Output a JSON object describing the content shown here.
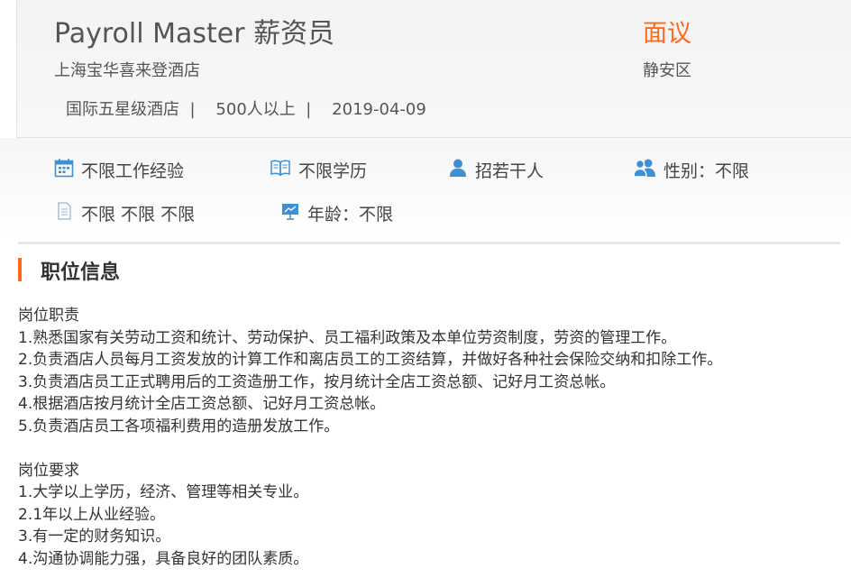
{
  "job": {
    "title": "Payroll Master 薪资员",
    "salary": "面议",
    "company": "上海宝华喜来登酒店",
    "district": "静安区",
    "meta": [
      "国际五星级酒店",
      "500人以上",
      "2019-04-09"
    ],
    "meta_separator": "|"
  },
  "requirements": {
    "experience": "不限工作经验",
    "education": "不限学历",
    "headcount": "招若干人",
    "gender": "性别：不限",
    "other": "不限 不限 不限",
    "age": "年龄：不限"
  },
  "section": {
    "title": "职位信息"
  },
  "description": {
    "duties_heading": "岗位职责",
    "duties": [
      "1.熟悉国家有关劳动工资和统计、劳动保护、员工福利政策及本单位劳资制度，劳资的管理工作。",
      "2.负责酒店人员每月工资发放的计算工作和离店员工的工资结算，并做好各种社会保险交纳和扣除工作。",
      "3.负责酒店员工正式聘用后的工资造册工作，按月统计全店工资总额、记好月工资总帐。",
      "4.根据酒店按月统计全店工资总额、记好月工资总帐。",
      "5.负责酒店员工各项福利费用的造册发放工作。"
    ],
    "requirements_heading": "岗位要求",
    "requirements": [
      "1.大学以上学历，经济、管理等相关专业。",
      "2.1年以上从业经验。",
      "3.有一定的财务知识。",
      "4.沟通协调能力强，具备良好的团队素质。"
    ]
  },
  "colors": {
    "accent": "#ff6a1a",
    "icon": "#3d8fd6"
  },
  "icons": [
    "calendar-icon",
    "book-icon",
    "person-icon",
    "people-icon",
    "document-icon",
    "presentation-icon"
  ]
}
